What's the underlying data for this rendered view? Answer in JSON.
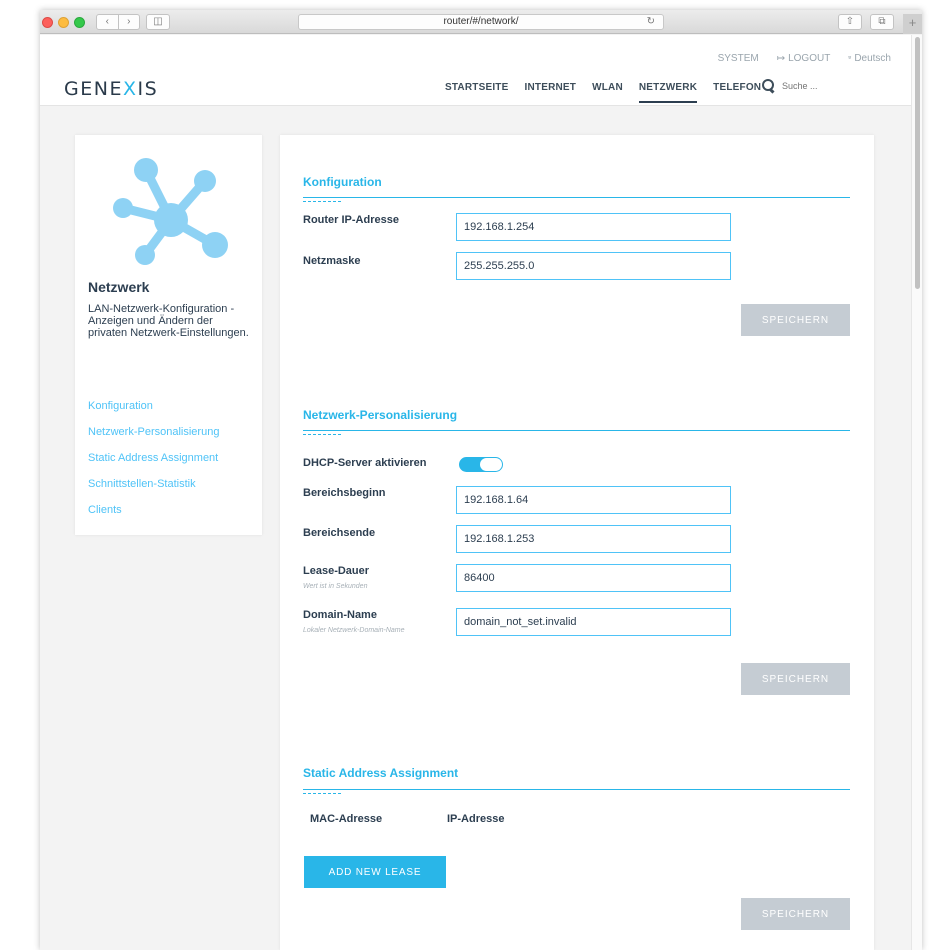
{
  "browser": {
    "url": "router/#/network/"
  },
  "header": {
    "logo": {
      "part1": "GENE",
      "part2": "X",
      "part3": "IS"
    },
    "top_links": [
      {
        "label": "SYSTEM"
      },
      {
        "label": "LOGOUT"
      },
      {
        "label": "Deutsch"
      }
    ],
    "nav": [
      {
        "label": "STARTSEITE"
      },
      {
        "label": "INTERNET"
      },
      {
        "label": "WLAN"
      },
      {
        "label": "NETZWERK"
      },
      {
        "label": "TELEFON"
      }
    ],
    "active_nav": "NETZWERK",
    "search": {
      "placeholder": "Suche ..."
    }
  },
  "sidebar": {
    "title": "Netzwerk",
    "description": "LAN-Netzwerk-Konfiguration - Anzeigen und Ändern der privaten Netzwerk-Einstellungen.",
    "icon": "network-icon",
    "links": [
      {
        "label": "Konfiguration"
      },
      {
        "label": "Netzwerk-Personalisierung"
      },
      {
        "label": "Static Address Assignment"
      },
      {
        "label": "Schnittstellen-Statistik"
      },
      {
        "label": "Clients"
      }
    ]
  },
  "konfiguration": {
    "title": "Konfiguration",
    "router_ip": {
      "label": "Router IP-Adresse",
      "value": "192.168.1.254"
    },
    "netmask": {
      "label": "Netzmaske",
      "value": "255.255.255.0"
    },
    "save_label": "SPEICHERN"
  },
  "personalisierung": {
    "title": "Netzwerk-Personalisierung",
    "dhcp": {
      "label": "DHCP-Server aktivieren",
      "enabled": true
    },
    "range_start": {
      "label": "Bereichsbeginn",
      "value": "192.168.1.64"
    },
    "range_end": {
      "label": "Bereichsende",
      "value": "192.168.1.253"
    },
    "lease": {
      "label": "Lease-Dauer",
      "hint": "Wert ist in Sekunden",
      "value": "86400"
    },
    "domain": {
      "label": "Domain-Name",
      "hint": "Lokaler Netzwerk-Domain-Name",
      "value": "domain_not_set.invalid"
    },
    "save_label": "SPEICHERN"
  },
  "static_assignment": {
    "title": "Static Address Assignment",
    "columns": [
      {
        "label": "MAC-Adresse"
      },
      {
        "label": "IP-Adresse"
      }
    ],
    "add_label": "ADD NEW LEASE",
    "save_label": "SPEICHERN"
  },
  "colors": {
    "accent": "#29b6e8",
    "text_dark": "#2c3e50",
    "button_disabled": "#c5ccd3"
  }
}
